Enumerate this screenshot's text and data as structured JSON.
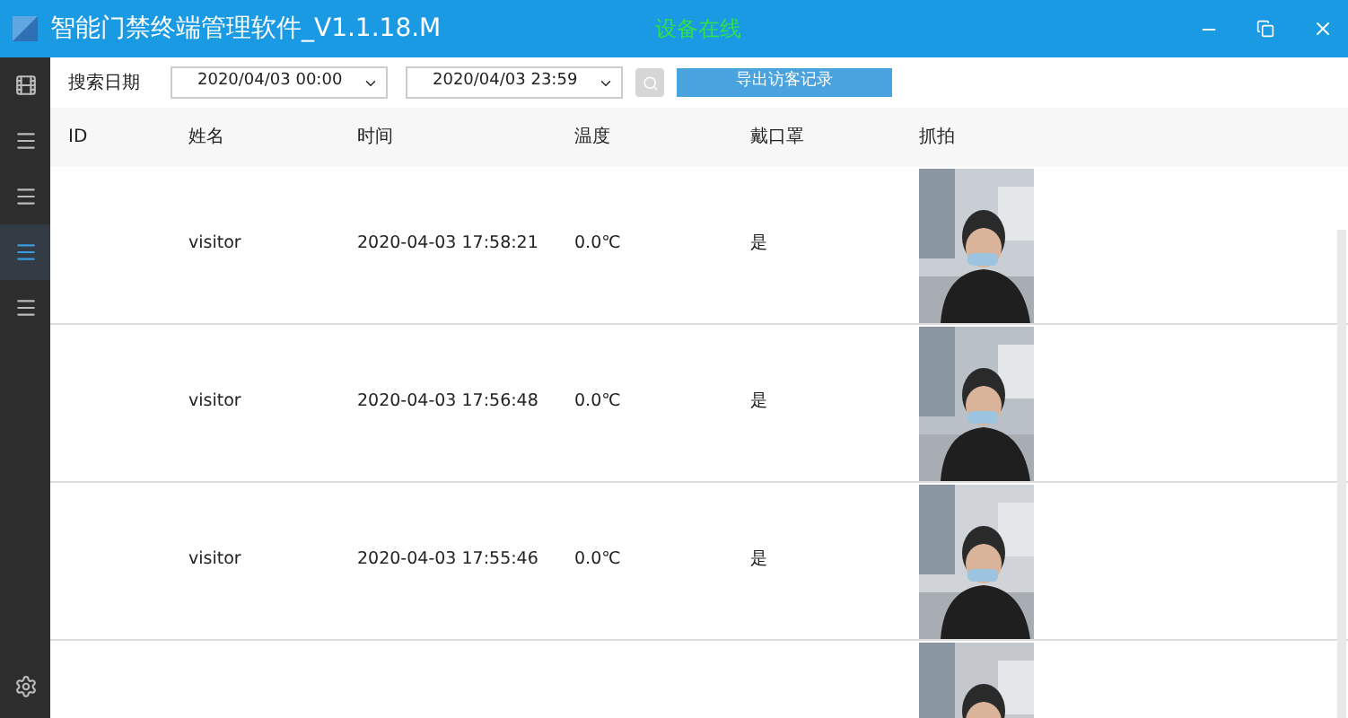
{
  "window": {
    "title": "智能门禁终端管理软件_V1.1.18.M",
    "status": "设备在线"
  },
  "sidebar": {
    "items": [
      {
        "kind": "film",
        "selected": false
      },
      {
        "kind": "menu",
        "selected": false
      },
      {
        "kind": "menu",
        "selected": false
      },
      {
        "kind": "menu",
        "selected": true
      },
      {
        "kind": "menu",
        "selected": false
      },
      {
        "kind": "settings",
        "selected": false
      }
    ]
  },
  "toolbar": {
    "date_label": "搜索日期",
    "start": "2020/04/03 00:00",
    "end": "2020/04/03 23:59",
    "export_button": "导出访客记录"
  },
  "table": {
    "columns": [
      "ID",
      "姓名",
      "时间",
      "温度",
      "戴口罩",
      "抓拍"
    ],
    "rows": [
      {
        "id": "",
        "name": "visitor",
        "time": "2020-04-03 17:58:21",
        "temperature": "0.0℃",
        "mask": "是",
        "snapshot": {
          "kind": "picture"
        }
      },
      {
        "id": "",
        "name": "visitor",
        "time": "2020-04-03 17:56:48",
        "temperature": "0.0℃",
        "mask": "是",
        "snapshot": {
          "kind": "picture"
        }
      },
      {
        "id": "",
        "name": "visitor",
        "time": "2020-04-03 17:55:46",
        "temperature": "0.0℃",
        "mask": "是",
        "snapshot": {
          "kind": "picture"
        }
      },
      {
        "snapshot": {
          "kind": "picture"
        }
      }
    ]
  }
}
